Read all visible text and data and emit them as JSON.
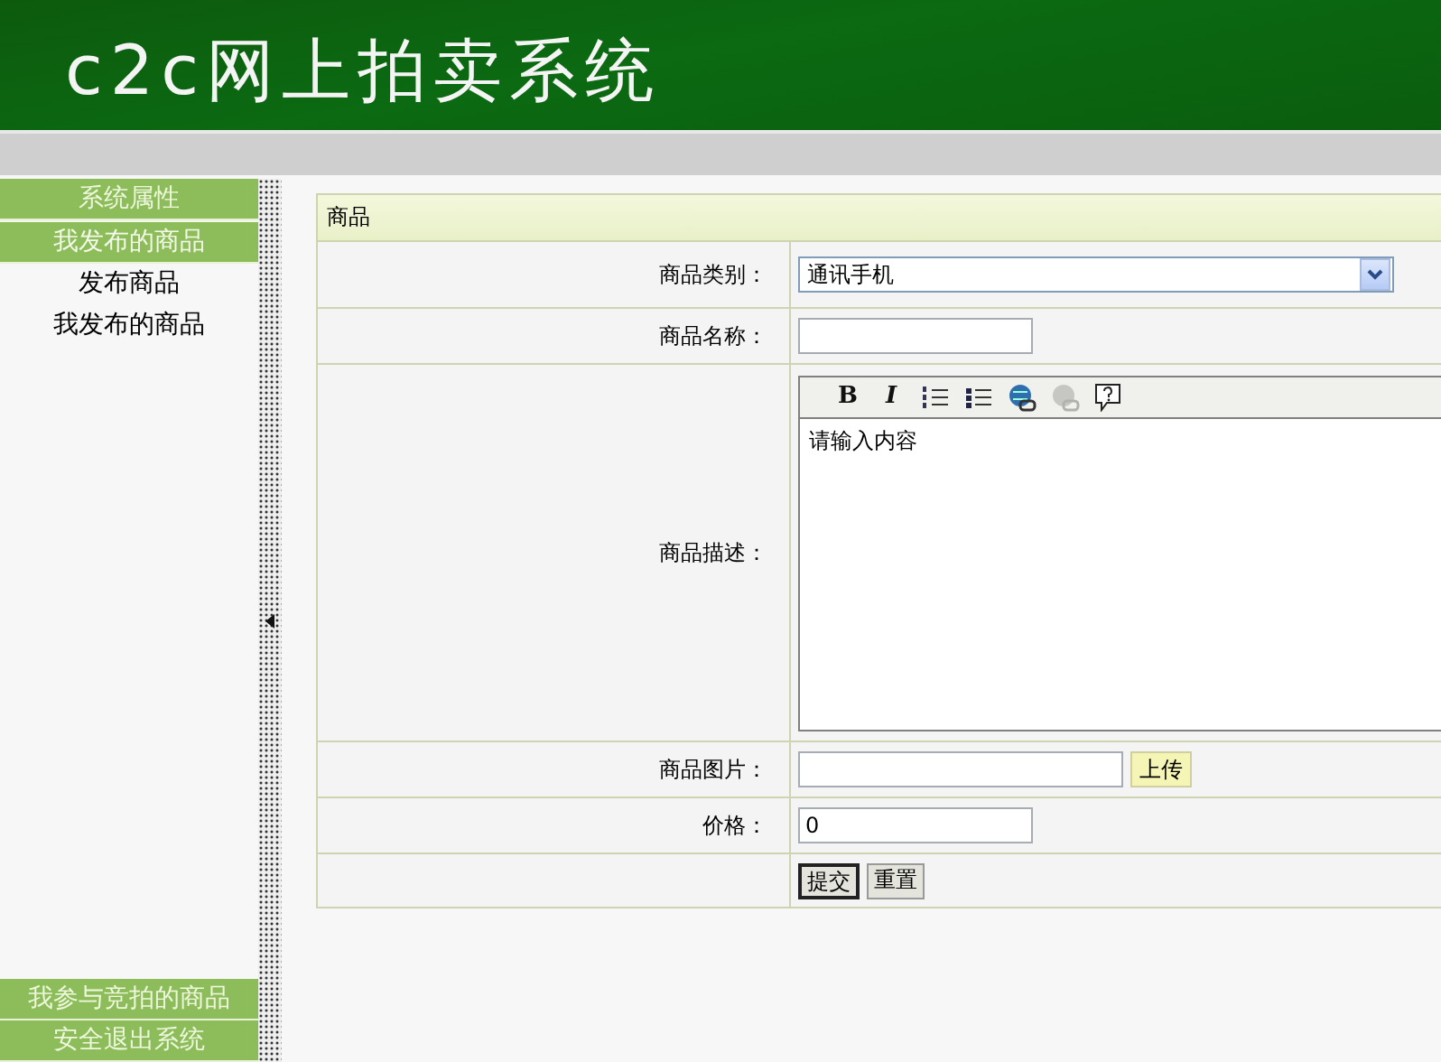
{
  "header": {
    "title": "c2c网上拍卖系统"
  },
  "sidebar": {
    "sections": [
      {
        "label": "系统属性",
        "expanded": false
      },
      {
        "label": "我发布的商品",
        "expanded": true,
        "children": [
          {
            "label": "发布商品"
          },
          {
            "label": "我发布的商品"
          }
        ]
      }
    ],
    "bottom_sections": [
      {
        "label": "我参与竞拍的商品",
        "expanded": false
      },
      {
        "label": "安全退出系统",
        "expanded": false
      }
    ]
  },
  "form": {
    "title": "商品",
    "fields": [
      {
        "kind": "select",
        "label": "商品类别：",
        "value": "通讯手机"
      },
      {
        "kind": "text",
        "label": "商品名称："
      },
      {
        "kind": "editor",
        "label": "商品描述：",
        "value": "请输入内容",
        "toolbar": [
          {
            "kind": "bold",
            "label": "B",
            "disabled": false
          },
          {
            "kind": "italic",
            "label": "I",
            "disabled": false
          },
          {
            "kind": "ordered-list",
            "disabled": false
          },
          {
            "kind": "bullet-list",
            "disabled": false
          },
          {
            "kind": "link",
            "disabled": false
          },
          {
            "kind": "unlink",
            "disabled": true
          },
          {
            "kind": "help",
            "disabled": false
          }
        ]
      },
      {
        "kind": "upload",
        "label": "商品图片：",
        "button": "上传"
      },
      {
        "kind": "text",
        "label": "价格：",
        "value": "0"
      }
    ],
    "buttons": [
      {
        "label": "提交",
        "default": true
      },
      {
        "label": "重置",
        "default": false
      }
    ]
  }
}
